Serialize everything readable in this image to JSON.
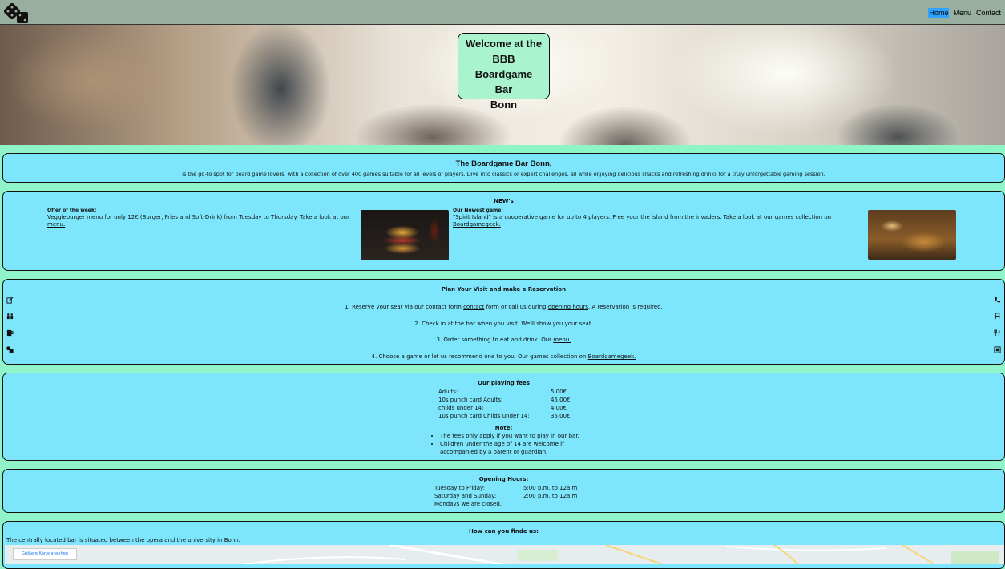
{
  "nav": {
    "links": [
      "Home",
      "Menu",
      "Contact"
    ]
  },
  "hero": {
    "title_lines": [
      "Welcome at the BBB",
      "Boardgame",
      "Bar",
      "Bonn"
    ]
  },
  "intro": {
    "title": "The Boardgame Bar Bonn,",
    "text": "is the go-to spot for board game lovers, with a collection of over 400 games suitable for all levels of players. Dive into classics or expert challenges, all while enjoying delicious snacks and refreshing drinks for a truly unforgettable gaming session."
  },
  "news": {
    "title": "NEW's",
    "offer": {
      "heading": "Offer of the week:",
      "text": "Veggieburger menu for only 12€ (Burger, Fries and Soft-Drink) from Tuesday to Thursday. Take a look at our ",
      "link": "menu."
    },
    "game": {
      "heading": "Our Newest game:",
      "text": "\"Spirit Island\" is a cooperative game for up to 4 players. Free your the island from the invaders. Take a look at our games collection on ",
      "link": "Boardgamegeek."
    }
  },
  "plan": {
    "title": "Plan Your Visit and make a Reservation",
    "step1": {
      "a": "1. Reserve your seat via our contact form ",
      "l1": "contact",
      "b": " form or call us during ",
      "l2": "opening hours",
      "c": ". A reservation is required."
    },
    "step2": {
      "a": "2. Check in at the bar when you visit. We'll show you your seat."
    },
    "step3": {
      "a": "3. Order something to eat and drink. Our ",
      "l1": "menu."
    },
    "step4": {
      "a": "4. Choose a game or let us recommend one to you. Our games collection on ",
      "l1": "Boardgamegeek."
    },
    "left_icons": [
      "edit-icon",
      "people-icon",
      "drink-icon",
      "dice-icon"
    ],
    "right_icons": [
      "phone-icon",
      "seat-icon",
      "cutlery-icon",
      "game-box-icon"
    ]
  },
  "fees": {
    "title": "Our playing fees",
    "rows": [
      {
        "label": "Adults:",
        "price": "5,00€"
      },
      {
        "label": "10s punch card Adults:",
        "price": "45,00€"
      },
      {
        "label": "childs under 14:",
        "price": "4,00€"
      },
      {
        "label": "10s punch card Childs under 14:",
        "price": "35,00€"
      }
    ],
    "note_title": "Note:",
    "notes": [
      "The fees only apply if you want to play in our bar.",
      "Children under the age of 14 are welcome if accompanied by a parent or guardian."
    ]
  },
  "hours": {
    "title": "Opening Hours:",
    "rows": [
      {
        "day": "Tuesday to Friday:",
        "time": "5:00 p.m. to 12a.m"
      },
      {
        "day": "Saturday and Sunday:",
        "time": "2:00 p.m. to 12a.m"
      }
    ],
    "closed": "Mondays we are closed."
  },
  "findus": {
    "title": "How can you finde us:",
    "text": "The centrally located bar is situated between the opera and the university in Bonn.",
    "map_button": "Größere Karte ansehen"
  },
  "colors": {
    "page_bg": "#8ff5c9",
    "card_bg": "#7ee6fc",
    "nav_bg": "#98ae9f",
    "active_link": "#2fa3ff",
    "hero_title_bg": "#a9f3cf"
  }
}
